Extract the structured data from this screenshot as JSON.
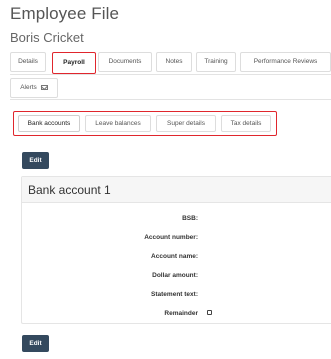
{
  "page": {
    "title": "Employee File",
    "employee_name": "Boris Cricket"
  },
  "main_tabs": [
    {
      "label": "Details"
    },
    {
      "label": "Payroll",
      "active": true
    },
    {
      "label": "Documents"
    },
    {
      "label": "Notes"
    },
    {
      "label": "Training"
    },
    {
      "label": "Performance Reviews"
    },
    {
      "label": "Alerts"
    }
  ],
  "sub_tabs": [
    {
      "label": "Bank accounts",
      "active": true
    },
    {
      "label": "Leave balances"
    },
    {
      "label": "Super details"
    },
    {
      "label": "Tax details"
    }
  ],
  "buttons": {
    "edit_top": "Edit",
    "edit_bottom": "Edit"
  },
  "bank_panel": {
    "title": "Bank account 1",
    "fields": [
      {
        "label": "BSB:",
        "value": ""
      },
      {
        "label": "Account number:",
        "value": ""
      },
      {
        "label": "Account name:",
        "value": ""
      },
      {
        "label": "Dollar amount:",
        "value": ""
      },
      {
        "label": "Statement text:",
        "value": ""
      },
      {
        "label": "Remainder",
        "checked": false
      }
    ]
  },
  "colors": {
    "highlight": "#e0262d",
    "button": "#34495e"
  },
  "icons": {
    "alerts": "envelope-icon"
  }
}
